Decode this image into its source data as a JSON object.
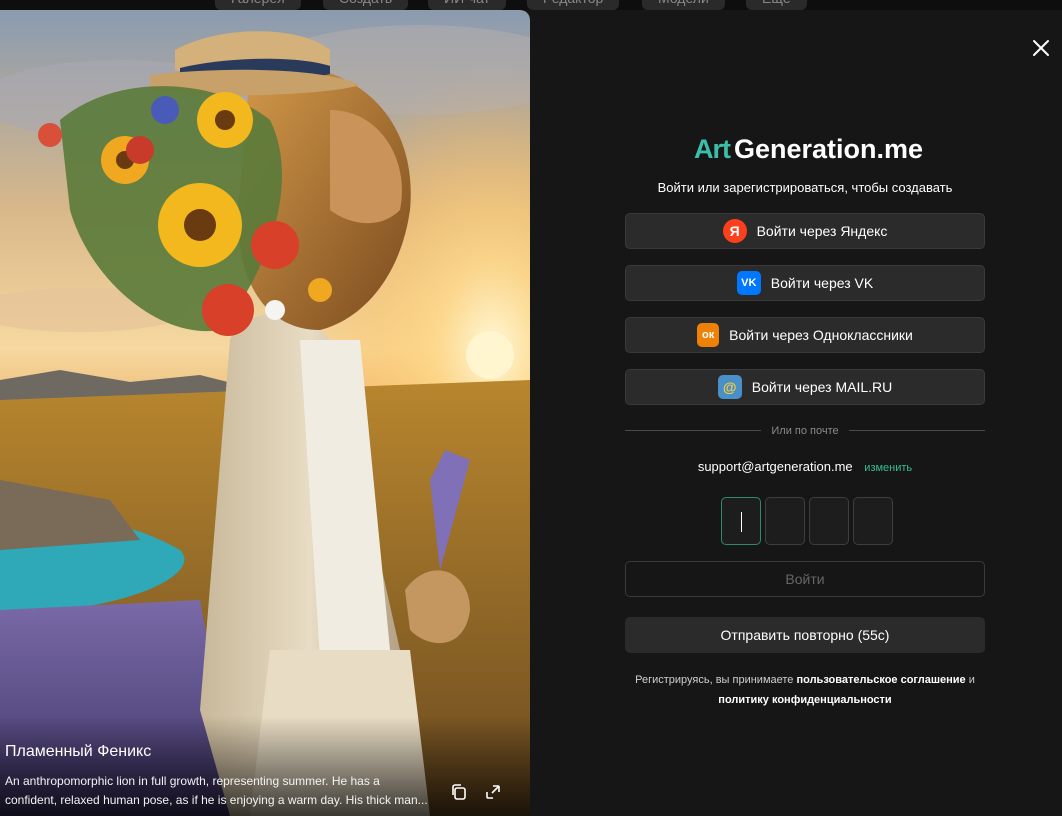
{
  "topnav": {
    "items": [
      "Галерея",
      "Создать",
      "ИИ-чат",
      "Редактор",
      "Модели",
      "Ещё"
    ]
  },
  "artwork": {
    "title": "Пламенный Феникс",
    "description": "An anthropomorphic lion in full growth, representing summer. He has a confident, relaxed human pose, as if he is enjoying a warm day. His thick man..."
  },
  "auth": {
    "logo_art": "Art",
    "logo_rest": "Generation.me",
    "subtitle": "Войти или зарегистрироваться, чтобы создавать",
    "providers": [
      {
        "label": "Войти через Яндекс",
        "glyph": "Я",
        "color": "#fc3f1d"
      },
      {
        "label": "Войти через VK",
        "glyph": "VK",
        "color": "#0077ff"
      },
      {
        "label": "Войти через Одноклассники",
        "glyph": "ок",
        "color": "#ee8208"
      },
      {
        "label": "Войти через MAIL.RU",
        "glyph": "@",
        "color": "#4a90c8"
      }
    ],
    "divider": "Или по почте",
    "email": "support@artgeneration.me",
    "change_link": "изменить",
    "login_button": "Войти",
    "resend_button": "Отправить повторно (55с)",
    "terms_prefix": "Регистрируясь, вы принимаете ",
    "terms_link1": "пользовательское соглашение",
    "terms_and": " и",
    "terms_link2": "политику конфиденциальности"
  },
  "colors": {
    "accent": "#35c08f",
    "panel_bg": "#161616",
    "button_bg": "#2b2b2b"
  }
}
